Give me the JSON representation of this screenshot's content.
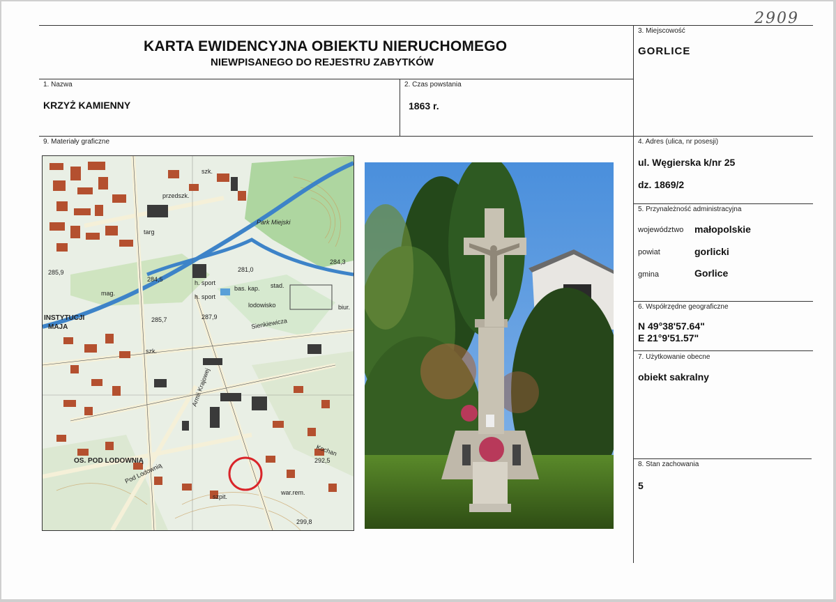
{
  "header": {
    "number": "2909",
    "title": "KARTA EWIDENCYJNA OBIEKTU NIERUCHOMEGO",
    "subtitle": "NIEWPISANEGO DO REJESTRU ZABYTKÓW"
  },
  "fields": {
    "miejscowosc": {
      "label": "3. Miejscowość",
      "value": "GORLICE"
    },
    "nazwa": {
      "label": "1. Nazwa",
      "value": "KRZYŻ KAMIENNY"
    },
    "czas": {
      "label": "2. Czas powstania",
      "value": "1863 r."
    },
    "materialy": {
      "label": "9. Materiały graficzne"
    },
    "adres": {
      "label": "4. Adres (ulica, nr posesji)",
      "line1": "ul. Węgierska k/nr 25",
      "line2": "dz. 1869/2"
    },
    "administracja": {
      "label": "5. Przynależność administracyjna",
      "wojewodztwo_label": "województwo",
      "wojewodztwo": "małopolskie",
      "powiat_label": "powiat",
      "powiat": "gorlicki",
      "gmina_label": "gmina",
      "gmina": "Gorlice"
    },
    "wspolrzedne": {
      "label": "6. Współrzędne geograficzne",
      "n": "N 49°38'57.64\"",
      "e": "E 21°9'51.57\""
    },
    "uzytkowanie": {
      "label": "7. Użytkowanie obecne",
      "value": "obiekt sakralny"
    },
    "stan": {
      "label": "8. Stan zachowania",
      "value": "5"
    }
  },
  "map": {
    "labels": {
      "park": "Park Miejski",
      "sport1": "h. sport",
      "sport2": "h. sport",
      "stad": "stad.",
      "baskap": "bas. kap.",
      "lodowisko": "lodowisko",
      "sienkiewicza": "Sienkiewicza",
      "instytucji": "INSTYTUCJI",
      "maja": "MAJA",
      "ospod": "OS. POD LODOWNIĄ",
      "podlodownia": "Pod Lodownią",
      "szpit": "szpit.",
      "warrem": "war.rem.",
      "elev1": "285,7",
      "elev2": "287,9",
      "elev3": "292,5",
      "elev4": "299,8",
      "elev5": "281,0",
      "elev6": "284,3",
      "elev7": "285,9",
      "elev8": "284,5",
      "szk1": "szk.",
      "szk2": "szk.",
      "biur": "biur.",
      "kochan": "Kochan",
      "targ": "targ",
      "przedszk": "przedszk.",
      "armii": "Armii Krajowej",
      "mag": "mag."
    }
  },
  "colors": {
    "map_bg": "#e9efe5",
    "street": "#f5f0d8",
    "building": "#b4502f",
    "river": "#3d83c8",
    "sky": "#5b9be0",
    "foliage": "#2e5a22",
    "stone": "#c8c2b3",
    "marker": "#d9252a"
  }
}
